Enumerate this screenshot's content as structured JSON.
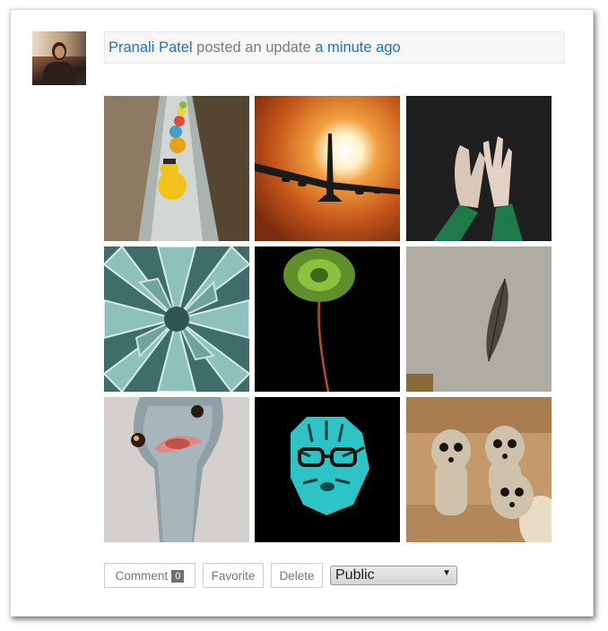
{
  "activity": {
    "author": "Pranali Patel",
    "action": "posted an update",
    "time": "a minute ago"
  },
  "gallery": {
    "images": [
      {
        "subject": "rubber ducks floating in a water channel"
      },
      {
        "subject": "airplane silhouette against the sun"
      },
      {
        "subject": "hands reaching up"
      },
      {
        "subject": "succulent agave plant"
      },
      {
        "subject": "green leaf on a stem on black"
      },
      {
        "subject": "feather fossil on stone"
      },
      {
        "subject": "ostrich head painting"
      },
      {
        "subject": "cyan tiger with glasses"
      },
      {
        "subject": "three meerkat pups"
      }
    ]
  },
  "actions": {
    "comment_label": "Comment",
    "comment_count": "0",
    "favorite_label": "Favorite",
    "delete_label": "Delete",
    "privacy_selected": "Public"
  },
  "colors": {
    "link": "#1e73be",
    "meta_text": "#7a7a7a",
    "header_bg": "#f7f7f7"
  }
}
